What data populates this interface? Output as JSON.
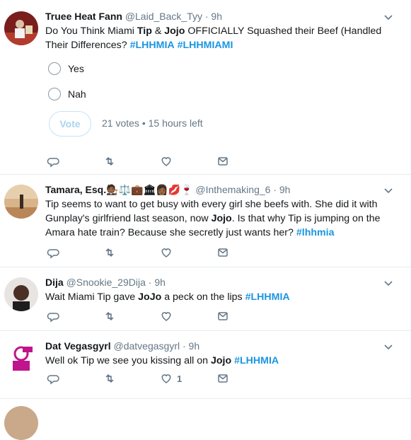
{
  "tweets": [
    {
      "name": "Truee Heat Fann",
      "handle": "@Laid_Back_Tyy",
      "time": "9h",
      "text": [
        {
          "t": "Do You Think Miami "
        },
        {
          "t": "Tip",
          "s": "bold"
        },
        {
          "t": " & "
        },
        {
          "t": "Jojo",
          "s": "bold"
        },
        {
          "t": " OFFICIALLY Squashed their Beef (Handled Their Differences? "
        },
        {
          "t": "#LHHMIA",
          "s": "tag"
        },
        {
          "t": " "
        },
        {
          "t": "#LHHMIAMI",
          "s": "tag"
        }
      ],
      "poll": {
        "options": [
          "Yes",
          "Nah"
        ],
        "vote_label": "Vote",
        "meta": "21 votes • 15 hours left"
      },
      "likes": ""
    },
    {
      "name": "Tamara, Esq.🧑🏾‍⚖️⚖️💼🏛👩🏾💋🍷",
      "handle": "@Inthemaking_6",
      "time": "9h",
      "text": [
        {
          "t": "Tip seems to want to get busy with every girl she beefs with. She did it with Gunplay's girlfriend last season, now "
        },
        {
          "t": "Jojo",
          "s": "bold"
        },
        {
          "t": ". Is that why Tip is jumping on the Amara hate train? Because she secretly just wants her? "
        },
        {
          "t": "#lhhmia",
          "s": "tag"
        }
      ],
      "likes": ""
    },
    {
      "name": "Dija",
      "handle": "@Snookie_29Dija",
      "time": "9h",
      "text": [
        {
          "t": "Wait Miami Tip gave "
        },
        {
          "t": "JoJo",
          "s": "bold"
        },
        {
          "t": " a peck on the lips "
        },
        {
          "t": "#LHHMIA",
          "s": "tag"
        }
      ],
      "likes": ""
    },
    {
      "name": "Dat Vegasgyrl",
      "handle": "@datvegasgyrl",
      "time": "9h",
      "text": [
        {
          "t": "Well ok Tip we see you kissing all on "
        },
        {
          "t": "Jojo",
          "s": "bold"
        },
        {
          "t": " "
        },
        {
          "t": "#LHHMIA",
          "s": "tag"
        }
      ],
      "likes": "1"
    }
  ],
  "colors": {
    "accent": "#1b95e0",
    "muted": "#657786",
    "border": "#e6ecf0"
  }
}
